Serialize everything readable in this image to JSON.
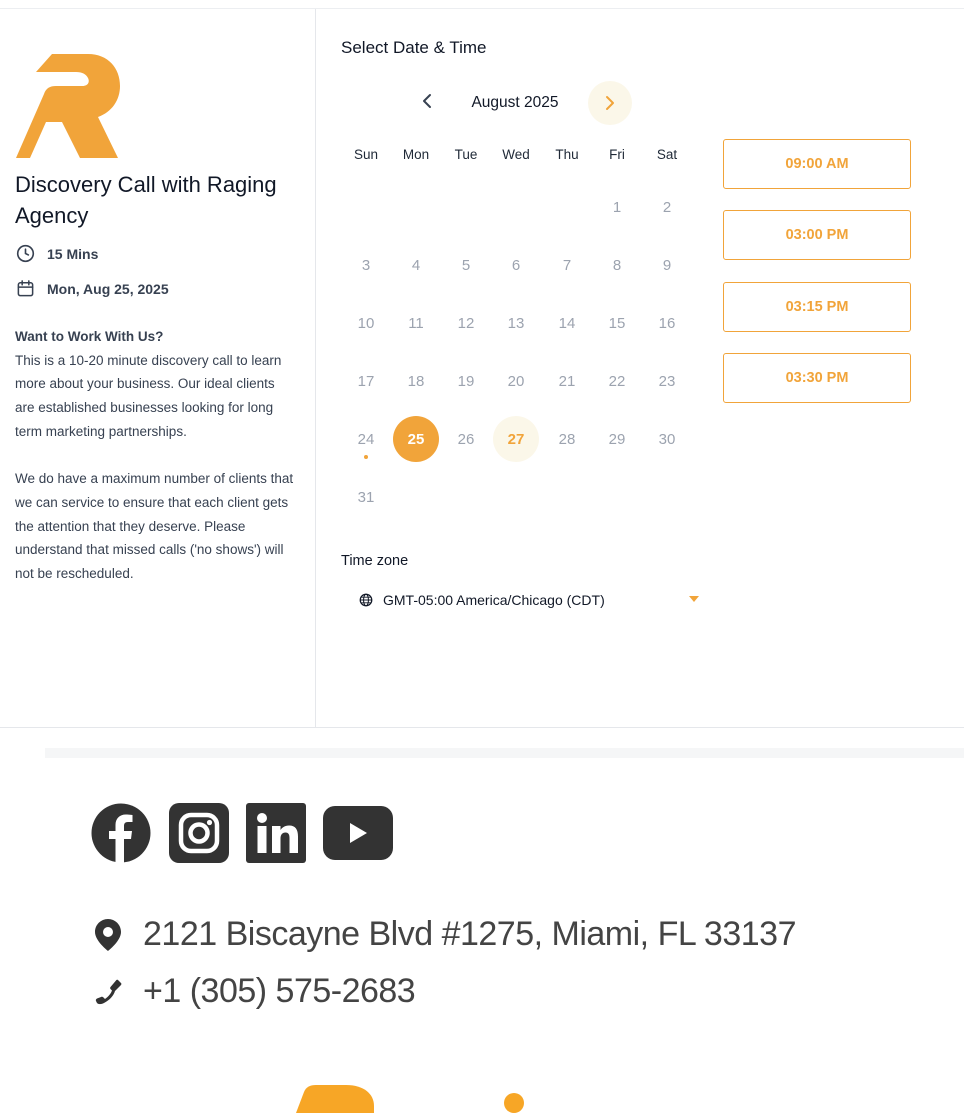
{
  "event": {
    "title": "Discovery Call with Raging Agency",
    "duration": "15 Mins",
    "date": "Mon, Aug 25, 2025",
    "description_heading": "Want to Work With Us?",
    "description_p1": "This is a 10-20 minute discovery call to learn more about your business. Our ideal clients are established businesses looking for long term marketing partnerships.",
    "description_p2": "We do have a maximum number of clients that we can service to ensure that each client gets the attention that they deserve. Please understand that missed calls ('no shows') will not be rescheduled."
  },
  "calendar": {
    "heading": "Select Date & Time",
    "month_label": "August 2025",
    "weekdays": [
      "Sun",
      "Mon",
      "Tue",
      "Wed",
      "Thu",
      "Fri",
      "Sat"
    ],
    "selected_day": 25,
    "available_days": [
      25,
      27
    ],
    "today_marker_day": 24
  },
  "time_slots": [
    "09:00 AM",
    "03:00 PM",
    "03:15 PM",
    "03:30 PM"
  ],
  "timezone": {
    "label": "Time zone",
    "value": "GMT-05:00 America/Chicago (CDT)"
  },
  "footer": {
    "social": [
      "facebook-icon",
      "instagram-icon",
      "linkedin-icon",
      "youtube-icon"
    ],
    "address": "2121 Biscayne Blvd #1275, Miami, FL 33137",
    "phone": "+1 (305) 575-2683"
  },
  "colors": {
    "accent": "#f1a43a",
    "accent_soft": "#fbf7e9",
    "icon_dark": "#333333"
  }
}
